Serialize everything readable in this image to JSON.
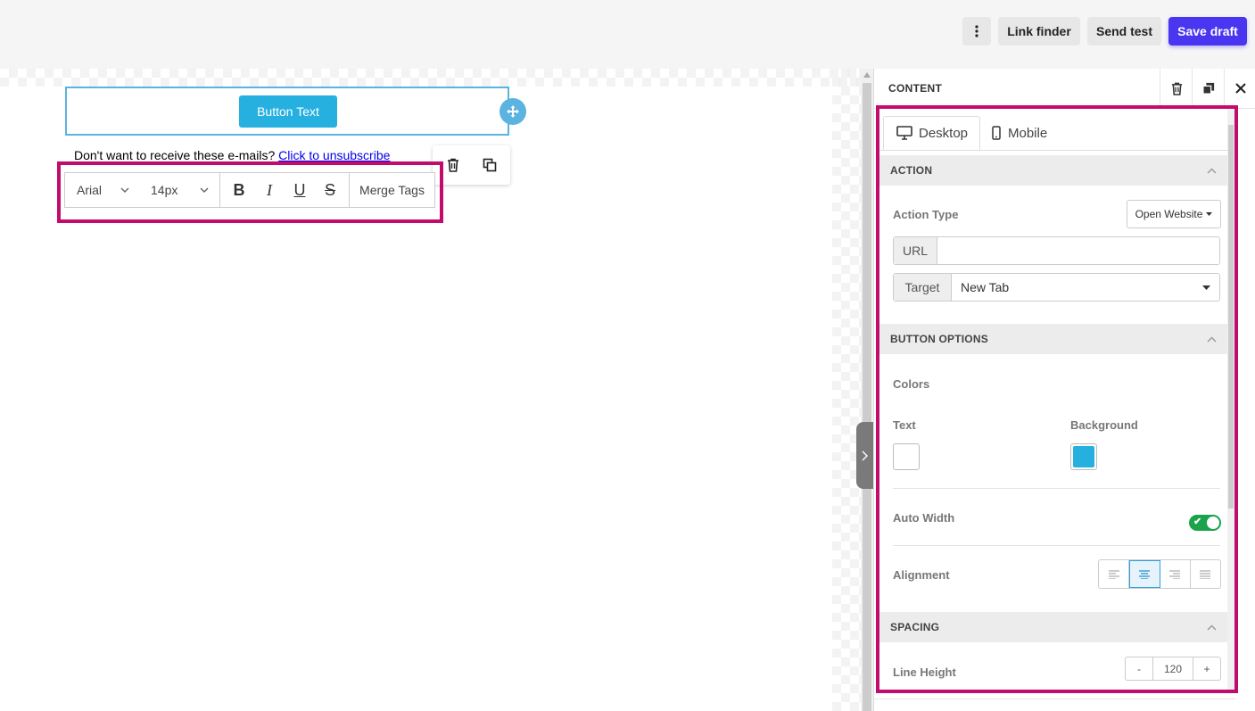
{
  "toolbar_top": {
    "more_icon": "more-vertical-icon",
    "link_finder": "Link finder",
    "send_test": "Send test",
    "save_draft": "Save draft",
    "primary_color": "#4a35f0"
  },
  "canvas": {
    "button_text": "Button Text",
    "button_color": "#26b0e0",
    "unsubscribe_text": "Don't want to receive these e-mails?",
    "unsubscribe_link": "Click to unsubscribe"
  },
  "text_toolbar": {
    "font": "Arial",
    "size": "14px",
    "bold": "B",
    "italic": "I",
    "underline": "U",
    "strike": "S",
    "merge_tags": "Merge Tags"
  },
  "panel": {
    "title": "CONTENT",
    "tabs": [
      {
        "label": "Desktop",
        "icon": "monitor-icon",
        "active": true
      },
      {
        "label": "Mobile",
        "icon": "phone-icon",
        "active": false
      }
    ],
    "action": {
      "header": "ACTION",
      "action_type_label": "Action Type",
      "action_type_value": "Open Website",
      "url_label": "URL",
      "url_value": "",
      "target_label": "Target",
      "target_value": "New Tab"
    },
    "button_options": {
      "header": "BUTTON OPTIONS",
      "colors_label": "Colors",
      "text_label": "Text",
      "text_color": "#ffffff",
      "background_label": "Background",
      "background_color": "#26b0e0",
      "auto_width_label": "Auto Width",
      "auto_width_on": true,
      "alignment_label": "Alignment",
      "alignment_selected": "center"
    },
    "spacing": {
      "header": "SPACING",
      "line_height_label": "Line Height",
      "minus": "-",
      "line_height_value": "120",
      "plus": "+"
    }
  },
  "highlight_color": "#c20c6d"
}
